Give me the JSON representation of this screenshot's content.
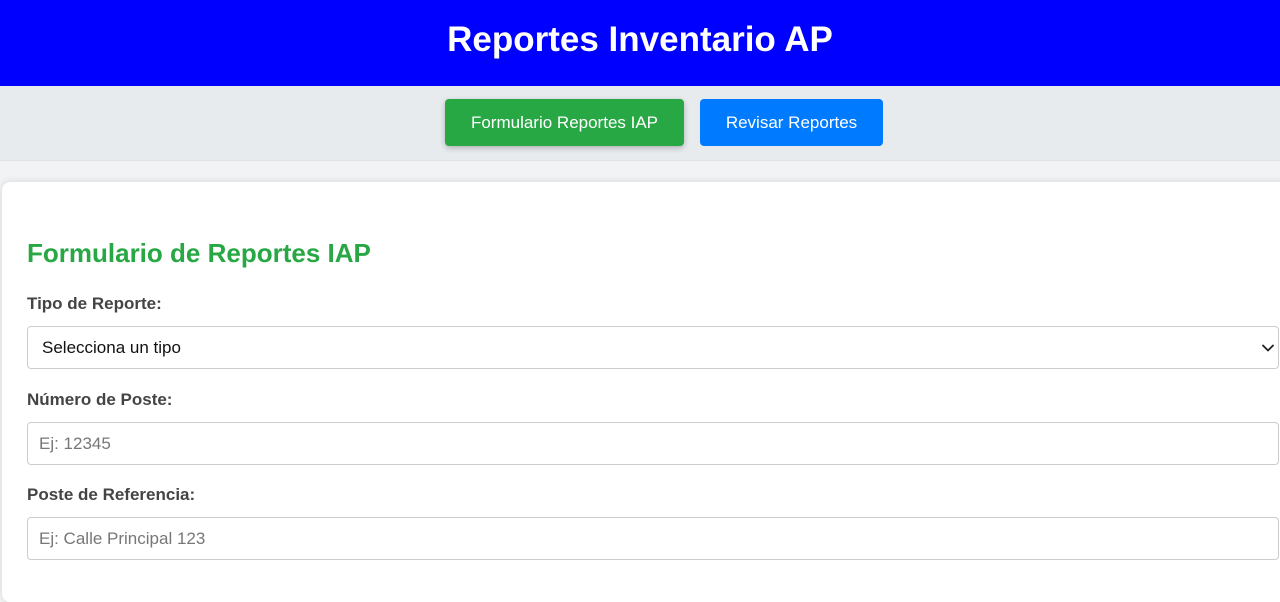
{
  "header": {
    "title": "Reportes Inventario AP"
  },
  "nav": {
    "items": [
      {
        "label": "Formulario Reportes IAP",
        "active": true
      },
      {
        "label": "Revisar Reportes",
        "active": false
      }
    ]
  },
  "form": {
    "title": "Formulario de Reportes IAP",
    "fields": [
      {
        "label": "Tipo de Reporte:",
        "type": "select",
        "value": "Selecciona un tipo"
      },
      {
        "label": "Número de Poste:",
        "type": "text",
        "value": "",
        "placeholder": "Ej: 12345"
      },
      {
        "label": "Poste de Referencia:",
        "type": "text",
        "value": "",
        "placeholder": "Ej: Calle Principal 123"
      }
    ]
  },
  "colors": {
    "header_bg": "#0000ff",
    "active_button": "#28a745",
    "secondary_button": "#007bff",
    "form_title": "#28a745"
  },
  "icons": {
    "select_arrow": "chevron-down-icon"
  }
}
